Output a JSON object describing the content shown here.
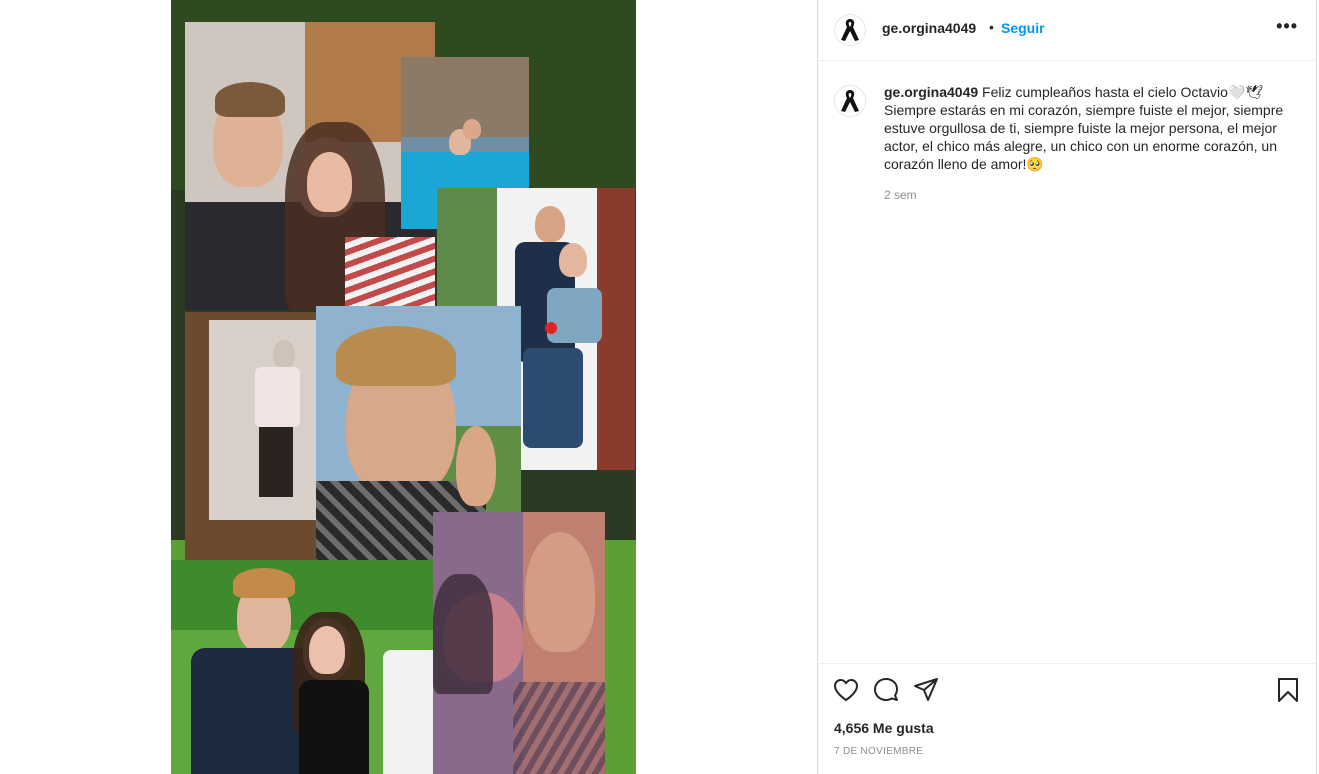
{
  "post": {
    "image_alt": "Collage de fotos",
    "author": "ge.orgina4049",
    "dot": "•",
    "follow_label": "Seguir",
    "more_label": "•••"
  },
  "caption": {
    "user": "ge.orgina4049",
    "text": " Feliz cumpleaños hasta el cielo Octavio🤍🕊 Siempre estarás en mi corazón, siempre fuiste el mejor, siempre estuve orgullosa de ti, siempre fuiste la mejor persona, el mejor actor, el chico más alegre, un chico con un enorme corazón, un corazón lleno de amor!🥺",
    "time_ago": "2 sem"
  },
  "actions": {
    "likes": "4,656 Me gusta",
    "date": "7 DE NOVIEMBRE"
  },
  "icons": {
    "like": "heart-icon",
    "comment": "comment-icon",
    "share": "paper-plane-icon",
    "save": "bookmark-icon",
    "avatar": "black-ribbon-icon"
  },
  "colors": {
    "accent": "#0095f6",
    "text": "#262626",
    "muted": "#8e8e8e",
    "border": "#dbdbdb"
  }
}
